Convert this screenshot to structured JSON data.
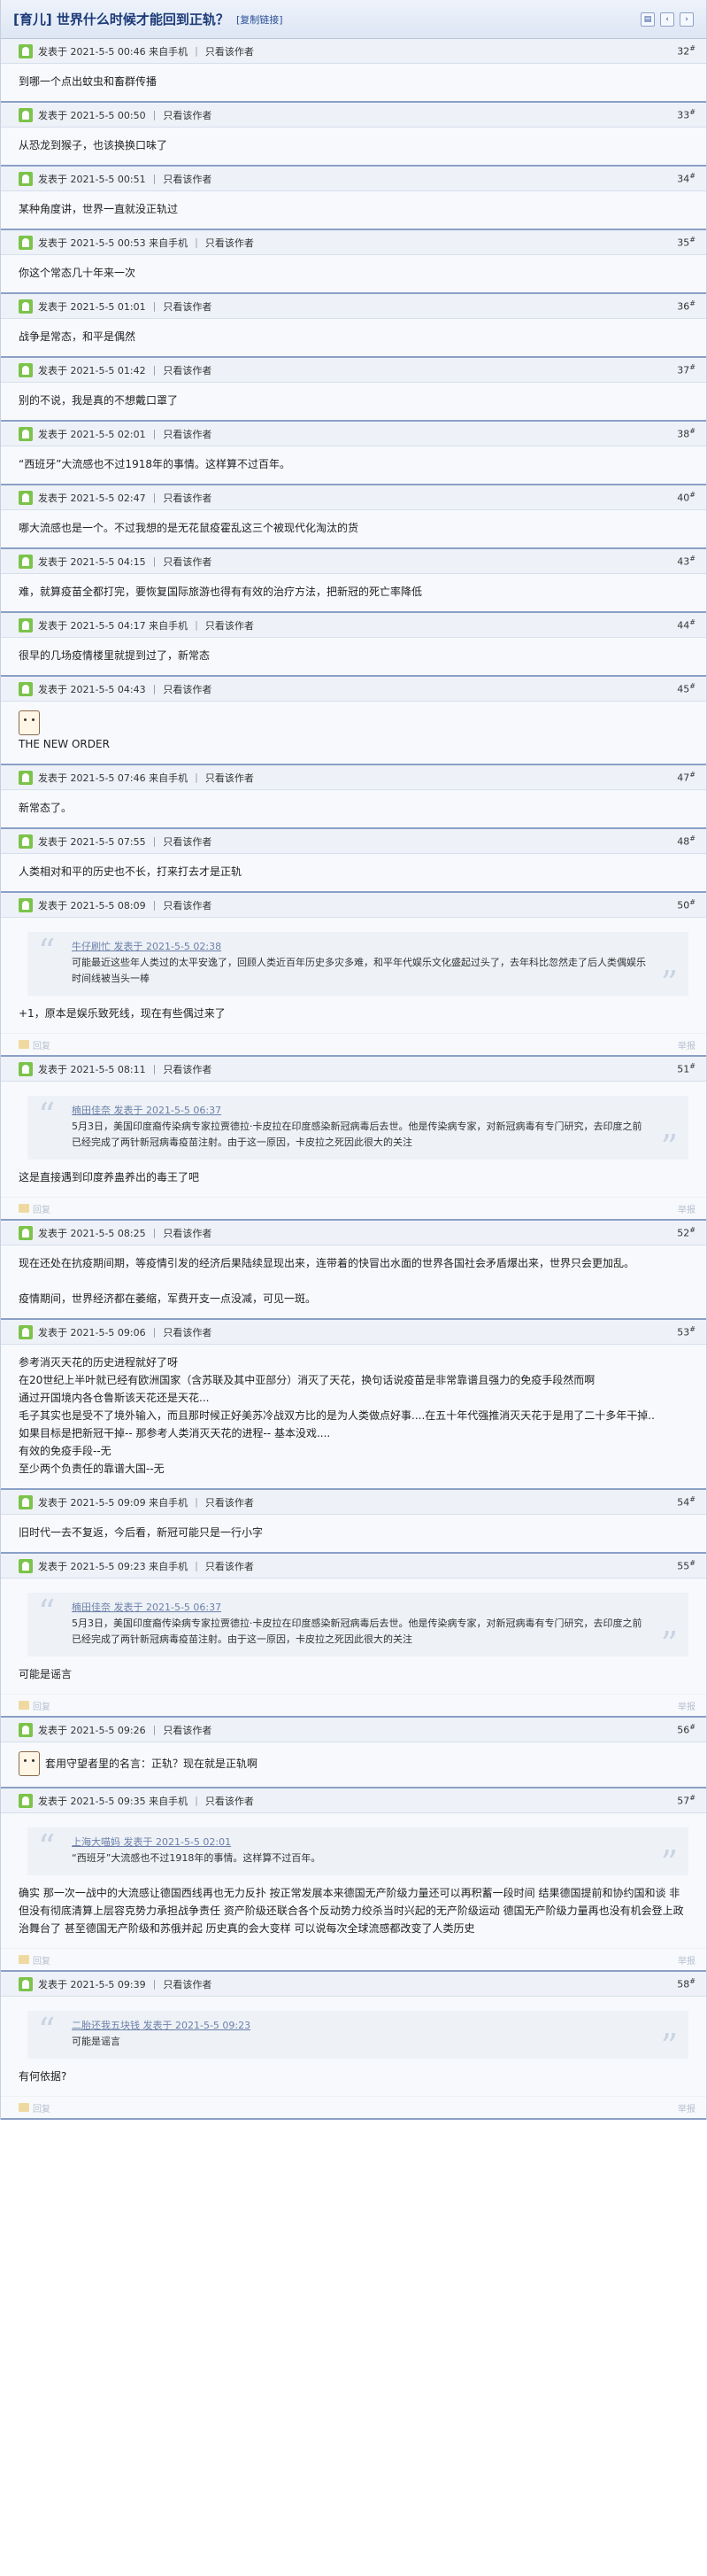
{
  "header": {
    "title": "[育儿] 世界什么时候才能回到正轨？",
    "copy_link": "[复制链接]"
  },
  "labels": {
    "only_op": "只看该作者",
    "reply": "回复",
    "report": "举报"
  },
  "posts": [
    {
      "time": "发表于 2021-5-5 00:46 来自手机",
      "floor": "32",
      "text": "到哪一个点出蚊虫和畜群传播"
    },
    {
      "time": "发表于 2021-5-5 00:50",
      "floor": "33",
      "text": "从恐龙到猴子，也该换换口味了"
    },
    {
      "time": "发表于 2021-5-5 00:51",
      "floor": "34",
      "text": "某种角度讲，世界一直就没正轨过"
    },
    {
      "time": "发表于 2021-5-5 00:53 来自手机",
      "floor": "35",
      "text": "你这个常态几十年来一次"
    },
    {
      "time": "发表于 2021-5-5 01:01",
      "floor": "36",
      "text": "战争是常态，和平是偶然"
    },
    {
      "time": "发表于 2021-5-5 01:42",
      "floor": "37",
      "text": "别的不说，我是真的不想戴口罩了"
    },
    {
      "time": "发表于 2021-5-5 02:01",
      "floor": "38",
      "text": "“西班牙”大流感也不过1918年的事情。这样算不过百年。"
    },
    {
      "time": "发表于 2021-5-5 02:47",
      "floor": "40",
      "text": "哪大流感也是一个。不过我想的是无花鼠疫霍乱这三个被现代化淘汰的货"
    },
    {
      "time": "发表于 2021-5-5 04:15",
      "floor": "43",
      "text": "难，就算疫苗全都打完，要恢复国际旅游也得有有效的治疗方法，把新冠的死亡率降低"
    },
    {
      "time": "发表于 2021-5-5 04:17 来自手机",
      "floor": "44",
      "text": "很早的几场疫情楼里就提到过了，新常态"
    },
    {
      "time": "发表于 2021-5-5 04:43",
      "floor": "45",
      "text": "THE NEW ORDER"
    },
    {
      "time": "发表于 2021-5-5 07:46 来自手机",
      "floor": "47",
      "text": "新常态了。"
    },
    {
      "time": "发表于 2021-5-5 07:55",
      "floor": "48",
      "text": "人类相对和平的历史也不长，打来打去才是正轨"
    },
    {
      "time": "发表于 2021-5-5 08:09",
      "floor": "50",
      "quote_meta": "牛仔刷忙 发表于 2021-5-5 02:38",
      "quote_text": "可能最近这些年人类过的太平安逸了，回顾人类近百年历史多灾多难，和平年代娱乐文化盛起过头了，去年科比忽然走了后人类偶娱乐时间线被当头一棒",
      "text": "+1，原本是娱乐致死线，现在有些偶过来了"
    },
    {
      "time": "发表于 2021-5-5 08:11",
      "floor": "51",
      "quote_meta": "楠田佳奈 发表于 2021-5-5 06:37",
      "quote_text": "5月3日，美国印度裔传染病专家拉贾德拉·卡皮拉在印度感染新冠病毒后去世。他是传染病专家，对新冠病毒有专门研究，去印度之前已经完成了两针新冠病毒疫苗注射。由于这一原因，卡皮拉之死因此很大的关注",
      "text": "这是直接遇到印度养蛊养出的毒王了吧"
    },
    {
      "time": "发表于 2021-5-5 08:25",
      "floor": "52",
      "text": "现在还处在抗疫期间期，等疫情引发的经济后果陆续显现出来，连带着的快冒出水面的世界各国社会矛盾爆出来，世界只会更加乱。",
      "text2": "疫情期间，世界经济都在萎缩，军费开支一点没减，可见一斑。"
    },
    {
      "time": "发表于 2021-5-5 09:06",
      "floor": "53",
      "lines": [
        "参考消灭天花的历史进程就好了呀",
        "在20世纪上半叶就已经有欧洲国家（含苏联及其中亚部分）消灭了天花，换句话说疫苗是非常靠谱且强力的免疫手段然而啊",
        "通过开国境内各仓鲁斯该天花还是天花...",
        "毛子其实也是受不了境外输入，而且那时候正好美苏冷战双方比的是为人类做点好事....在五十年代强推消灭天花于是用了二十多年干掉..",
        "如果目标是把新冠干掉-- 那参考人类消灭天花的进程-- 基本没戏....",
        "有效的免疫手段--无",
        "至少两个负责任的靠谱大国--无"
      ]
    },
    {
      "time": "发表于 2021-5-5 09:09 来自手机",
      "floor": "54",
      "text": "旧时代一去不复返，今后看，新冠可能只是一行小字"
    },
    {
      "time": "发表于 2021-5-5 09:23 来自手机",
      "floor": "55",
      "quote_meta": "楠田佳奈 发表于 2021-5-5 06:37",
      "quote_text": "5月3日，美国印度裔传染病专家拉贾德拉·卡皮拉在印度感染新冠病毒后去世。他是传染病专家，对新冠病毒有专门研究，去印度之前已经完成了两针新冠病毒疫苗注射。由于这一原因，卡皮拉之死因此很大的关注",
      "text": "可能是谣言"
    },
    {
      "time": "发表于 2021-5-5 09:26",
      "floor": "56",
      "text": "套用守望者里的名言：正轨？现在就是正轨啊"
    },
    {
      "time": "发表于 2021-5-5 09:35 来自手机",
      "floor": "57",
      "quote_meta": "上海大喵妈 发表于 2021-5-5 02:01",
      "quote_text": "“西班牙”大流感也不过1918年的事情。这样算不过百年。",
      "text": "确实 那一次一战中的大流感让德国西线再也无力反扑 按正常发展本来德国无产阶级力量还可以再积蓄一段时间 结果德国提前和协约国和谈 非但没有彻底清算上层容克势力承担战争责任 资产阶级还联合各个反动势力绞杀当时兴起的无产阶级运动 德国无产阶级力量再也没有机会登上政治舞台了 甚至德国无产阶级和苏俄并起 历史真的会大变样 可以说每次全球流感都改变了人类历史"
    },
    {
      "time": "发表于 2021-5-5 09:39",
      "floor": "58",
      "quote_meta": "二胎还我五块钱 发表于 2021-5-5 09:23",
      "quote_text": "可能是谣言",
      "text": "有何依据?"
    }
  ]
}
